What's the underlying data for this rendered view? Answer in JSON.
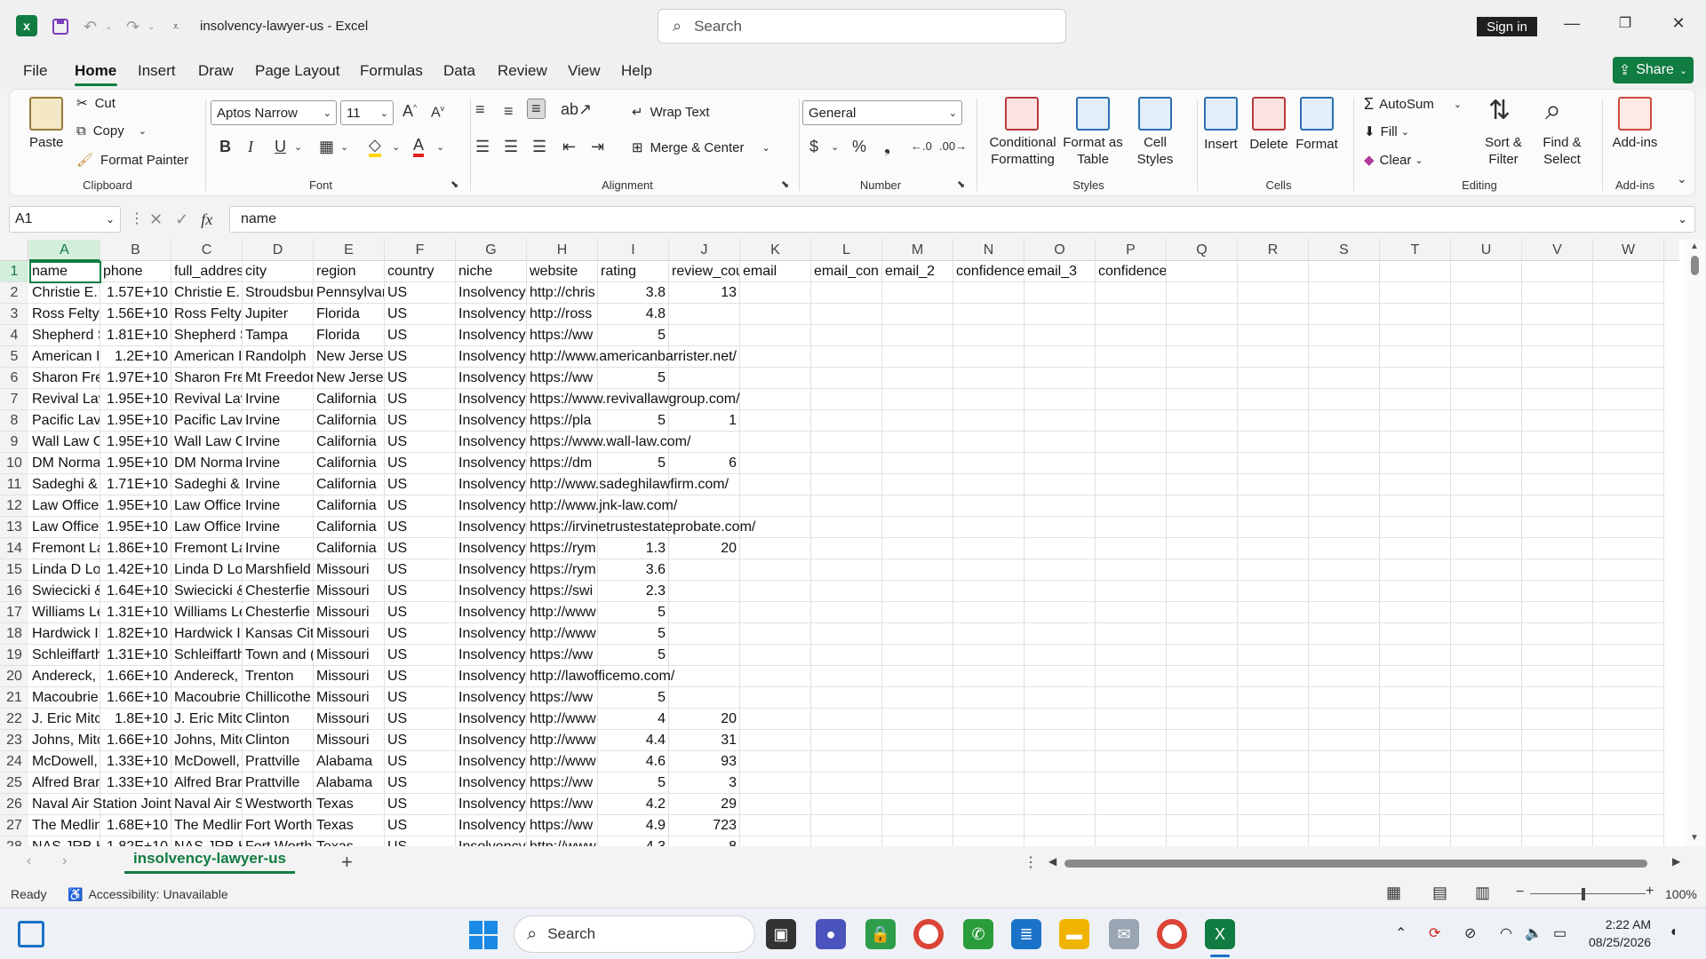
{
  "window": {
    "doc_title": "insolvency-lawyer-us  -  Excel",
    "search_placeholder": "Search",
    "sign_in": "Sign in"
  },
  "menu": {
    "items": [
      "File",
      "Home",
      "Insert",
      "Draw",
      "Page Layout",
      "Formulas",
      "Data",
      "Review",
      "View",
      "Help"
    ],
    "share": "Share"
  },
  "ribbon": {
    "clipboard": {
      "paste": "Paste",
      "cut": "Cut",
      "copy": "Copy",
      "format_painter": "Format Painter",
      "label": "Clipboard"
    },
    "font": {
      "name": "Aptos Narrow",
      "size": "11",
      "label": "Font"
    },
    "alignment": {
      "wrap_text": "Wrap Text",
      "merge_center": "Merge & Center",
      "label": "Alignment"
    },
    "number": {
      "format": "General",
      "label": "Number"
    },
    "styles": {
      "conditional": "Conditional",
      "conditional2": "Formatting",
      "format_table": "Format as",
      "format_table2": "Table",
      "cell_styles": "Cell",
      "cell_styles2": "Styles",
      "label": "Styles"
    },
    "cells": {
      "insert": "Insert",
      "delete": "Delete",
      "format": "Format",
      "label": "Cells"
    },
    "editing": {
      "autosum": "AutoSum",
      "fill": "Fill",
      "clear": "Clear",
      "sort": "Sort &",
      "sort2": "Filter",
      "find": "Find &",
      "find2": "Select",
      "label": "Editing"
    },
    "addins": {
      "addins": "Add-ins",
      "label": "Add-ins"
    }
  },
  "formula_bar": {
    "name_box": "A1",
    "formula": "name"
  },
  "sheet": {
    "columns": [
      "A",
      "B",
      "C",
      "D",
      "E",
      "F",
      "G",
      "H",
      "I",
      "J",
      "K",
      "L",
      "M",
      "N",
      "O",
      "P",
      "Q",
      "R",
      "S",
      "T",
      "U",
      "V",
      "W"
    ],
    "rows": [
      [
        "name",
        "phone",
        "full_addres",
        "city",
        "region",
        "country",
        "niche",
        "website",
        "rating",
        "review_cou",
        "email",
        "email_con",
        "email_2",
        "confidence",
        "email_3",
        "confidence_3"
      ],
      [
        "Christie E.",
        "1.57E+10",
        "Christie E.",
        "Stroudsbur",
        "Pennsylvar",
        "US",
        "Insolvency",
        "http://chris",
        "3.8",
        "13",
        "",
        "",
        "",
        "",
        "",
        ""
      ],
      [
        "Ross Felty",
        "1.56E+10",
        "Ross Felty,",
        "Jupiter",
        "Florida",
        "US",
        "Insolvency",
        "http://ross",
        "4.8",
        "",
        "",
        "",
        "",
        "",
        "",
        ""
      ],
      [
        "Shepherd S",
        "1.81E+10",
        "Shepherd S",
        "Tampa",
        "Florida",
        "US",
        "Insolvency",
        "https://ww",
        "5",
        "",
        "",
        "",
        "",
        "",
        "",
        ""
      ],
      [
        "American I",
        "1.2E+10",
        "American I",
        "Randolph",
        "New Jersey",
        "US",
        "Insolvency",
        "http://www.americanbarrister.net/",
        "",
        "",
        "",
        "",
        "",
        "",
        "",
        ""
      ],
      [
        "Sharon Fre",
        "1.97E+10",
        "Sharon Fre",
        "Mt Freedor",
        "New Jersey",
        "US",
        "Insolvency",
        "https://ww",
        "5",
        "",
        "",
        "",
        "",
        "",
        "",
        ""
      ],
      [
        "Revival Lav",
        "1.95E+10",
        "Revival Lav",
        "Irvine",
        "California",
        "US",
        "Insolvency",
        "https://www.revivallawgroup.com/",
        "",
        "",
        "",
        "",
        "",
        "",
        "",
        ""
      ],
      [
        "Pacific Lav",
        "1.95E+10",
        "Pacific Lav",
        "Irvine",
        "California",
        "US",
        "Insolvency",
        "https://pla",
        "5",
        "1",
        "",
        "",
        "",
        "",
        "",
        ""
      ],
      [
        "Wall Law C",
        "1.95E+10",
        "Wall Law C",
        "Irvine",
        "California",
        "US",
        "Insolvency",
        "https://www.wall-law.com/",
        "",
        "",
        "",
        "",
        "",
        "",
        "",
        ""
      ],
      [
        "DM Norma",
        "1.95E+10",
        "DM Norma",
        "Irvine",
        "California",
        "US",
        "Insolvency",
        "https://dm",
        "5",
        "6",
        "",
        "",
        "",
        "",
        "",
        ""
      ],
      [
        "Sadeghi & ,",
        "1.71E+10",
        "Sadeghi & ,",
        "Irvine",
        "California",
        "US",
        "Insolvency",
        "http://www.sadeghilawfirm.com/",
        "",
        "",
        "",
        "",
        "",
        "",
        "",
        ""
      ],
      [
        "Law Office",
        "1.95E+10",
        "Law Office",
        "Irvine",
        "California",
        "US",
        "Insolvency",
        "http://www.jnk-law.com/",
        "",
        "",
        "",
        "",
        "",
        "",
        "",
        ""
      ],
      [
        "Law Office",
        "1.95E+10",
        "Law Office",
        "Irvine",
        "California",
        "US",
        "Insolvency",
        "https://irvinetrustestateprobate.com/",
        "",
        "",
        "",
        "",
        "",
        "",
        "",
        ""
      ],
      [
        "Fremont La",
        "1.86E+10",
        "Fremont La",
        "Irvine",
        "California",
        "US",
        "Insolvency",
        "https://rym",
        "1.3",
        "20",
        "",
        "",
        "",
        "",
        "",
        ""
      ],
      [
        "Linda D Lot",
        "1.42E+10",
        "Linda D Lot",
        "Marshfield",
        "Missouri",
        "US",
        "Insolvency",
        "https://rym",
        "3.6",
        "",
        "",
        "",
        "",
        "",
        "",
        ""
      ],
      [
        "Swiecicki &",
        "1.64E+10",
        "Swiecicki &",
        "Chesterfie",
        "Missouri",
        "US",
        "Insolvency",
        "https://swi",
        "2.3",
        "",
        "",
        "",
        "",
        "",
        "",
        ""
      ],
      [
        "Williams Le",
        "1.31E+10",
        "Williams Le",
        "Chesterfie",
        "Missouri",
        "US",
        "Insolvency",
        "http://www",
        "5",
        "",
        "",
        "",
        "",
        "",
        "",
        ""
      ],
      [
        "Hardwick I",
        "1.82E+10",
        "Hardwick I",
        "Kansas Cit",
        "Missouri",
        "US",
        "Insolvency",
        "http://www",
        "5",
        "",
        "",
        "",
        "",
        "",
        "",
        ""
      ],
      [
        "Schleiffarth",
        "1.31E+10",
        "Schleiffarth",
        "Town and (",
        "Missouri",
        "US",
        "Insolvency",
        "https://ww",
        "5",
        "",
        "",
        "",
        "",
        "",
        "",
        ""
      ],
      [
        "Andereck,",
        "1.66E+10",
        "Andereck,",
        "Trenton",
        "Missouri",
        "US",
        "Insolvency",
        "http://lawofficemo.com/",
        "",
        "",
        "",
        "",
        "",
        "",
        "",
        ""
      ],
      [
        "Macoubrie",
        "1.66E+10",
        "Macoubrie",
        "Chillicothe",
        "Missouri",
        "US",
        "Insolvency",
        "https://ww",
        "5",
        "",
        "",
        "",
        "",
        "",
        "",
        ""
      ],
      [
        "J. Eric Mitc",
        "1.8E+10",
        "J. Eric Mitc",
        "Clinton",
        "Missouri",
        "US",
        "Insolvency",
        "http://www",
        "4",
        "20",
        "",
        "",
        "",
        "",
        "",
        ""
      ],
      [
        "Johns, Mitc",
        "1.66E+10",
        "Johns, Mitc",
        "Clinton",
        "Missouri",
        "US",
        "Insolvency",
        "http://www",
        "4.4",
        "31",
        "",
        "",
        "",
        "",
        "",
        ""
      ],
      [
        "McDowell,",
        "1.33E+10",
        "McDowell,",
        "Prattville",
        "Alabama",
        "US",
        "Insolvency",
        "http://www",
        "4.6",
        "93",
        "",
        "",
        "",
        "",
        "",
        ""
      ],
      [
        "Alfred Brar",
        "1.33E+10",
        "Alfred Brar",
        "Prattville",
        "Alabama",
        "US",
        "Insolvency",
        "https://ww",
        "5",
        "3",
        "",
        "",
        "",
        "",
        "",
        ""
      ],
      [
        "Naval Air Station Joint",
        "",
        "Naval Air S",
        "Westworth",
        "Texas",
        "US",
        "Insolvency",
        "https://ww",
        "4.2",
        "29",
        "",
        "",
        "",
        "",
        "",
        ""
      ],
      [
        "The Medlin",
        "1.68E+10",
        "The Medlin",
        "Fort Worth",
        "Texas",
        "US",
        "Insolvency",
        "https://ww",
        "4.9",
        "723",
        "",
        "",
        "",
        "",
        "",
        ""
      ],
      [
        "NAS JRB H",
        "1.82E+10",
        "NAS JRB H",
        "Fort Worth",
        "Texas",
        "US",
        "Insolvency",
        "http://www",
        "4.3",
        "8",
        "",
        "",
        "",
        "",
        "",
        ""
      ]
    ]
  },
  "tabs": {
    "sheet_name": "insolvency-lawyer-us",
    "add": "+"
  },
  "status": {
    "ready": "Ready",
    "accessibility": "Accessibility: Unavailable",
    "zoom": "100%"
  },
  "taskbar": {
    "search": "Search",
    "time": "2:22 AM",
    "date": "08/25/2026"
  }
}
